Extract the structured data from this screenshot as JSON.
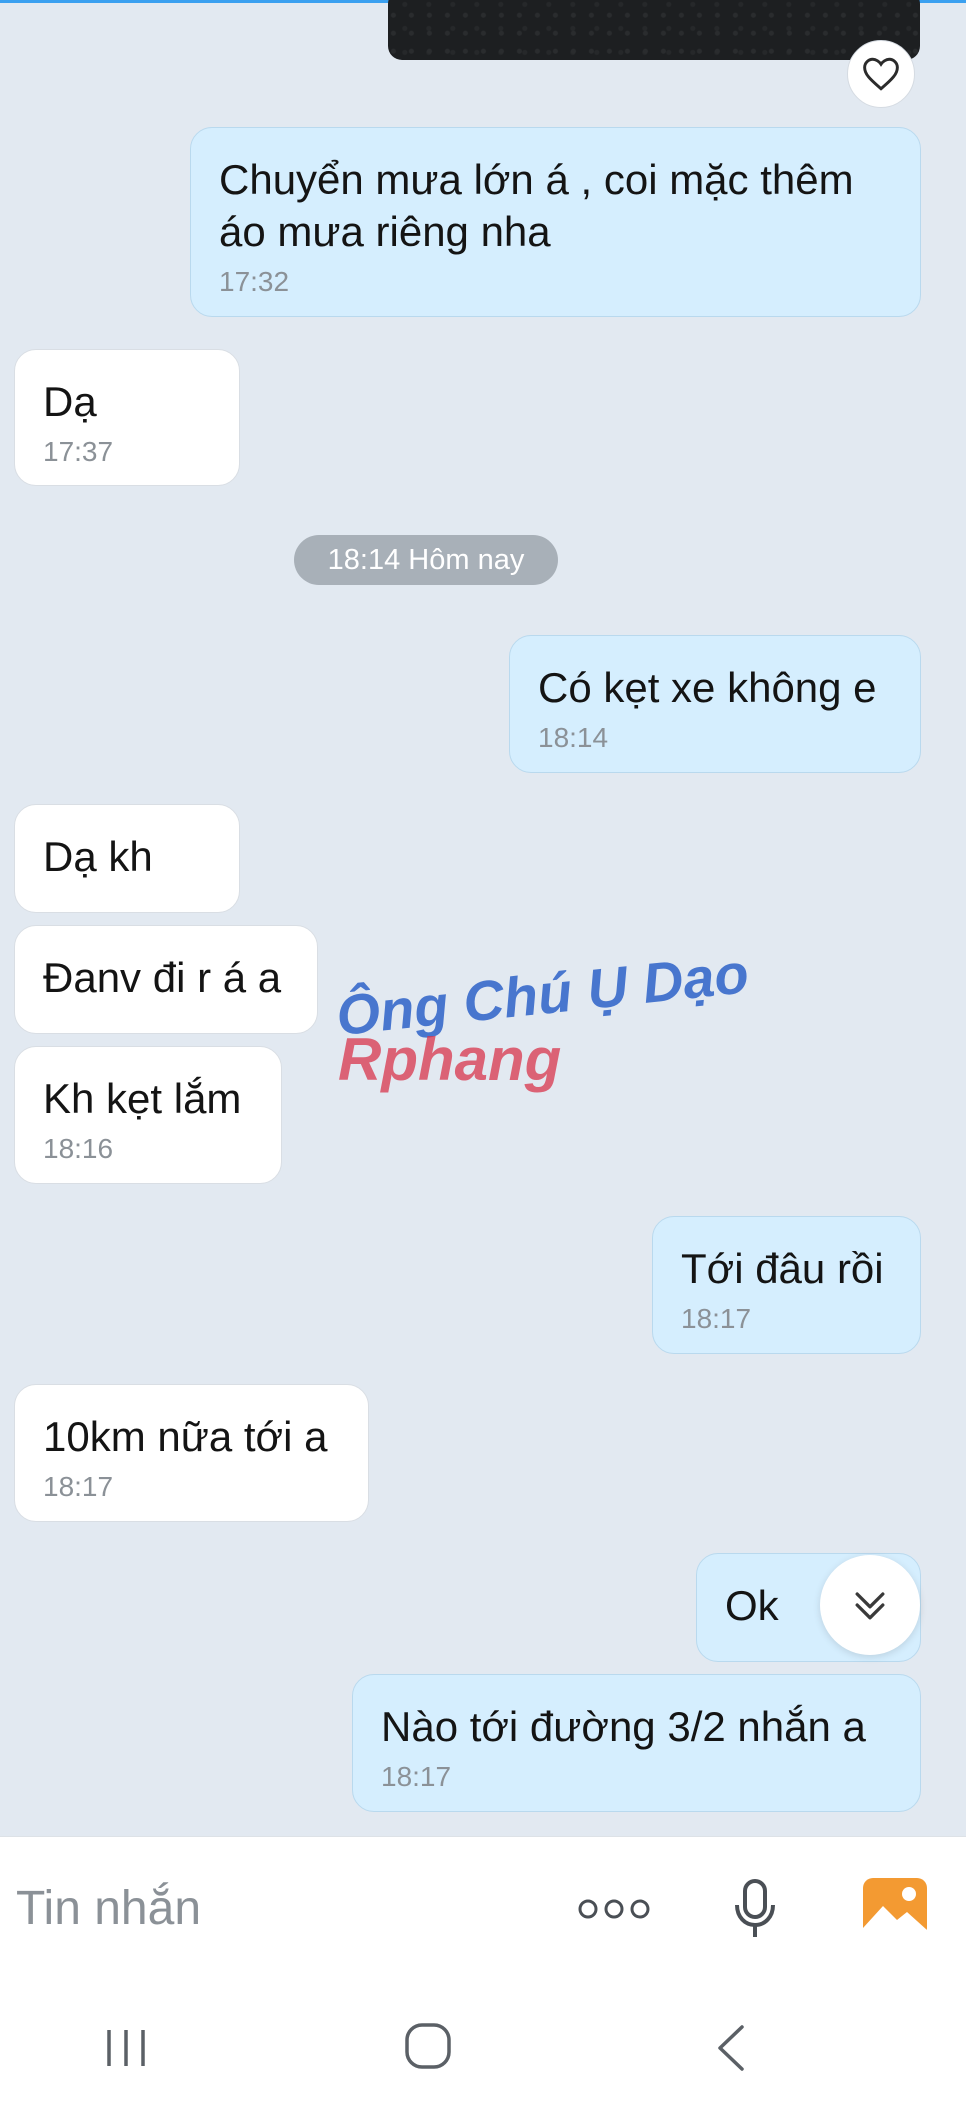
{
  "messages": [
    {
      "dir": "out",
      "text": "Chuyển mưa lớn á , coi mặc thêm",
      "text2": "áo mưa riêng nha",
      "time": "17:32"
    },
    {
      "dir": "in",
      "text": "Dạ",
      "time": "17:37"
    },
    {
      "dir": "out",
      "text": "Có kẹt xe không e",
      "time": "18:14"
    },
    {
      "dir": "in",
      "text": "Dạ kh"
    },
    {
      "dir": "in",
      "text": "Đanv đi r á a"
    },
    {
      "dir": "in",
      "text": "Kh kẹt lắm",
      "time": "18:16"
    },
    {
      "dir": "out",
      "text": "Tới đâu rồi",
      "time": "18:17"
    },
    {
      "dir": "in",
      "text": "10km nữa tới a",
      "time": "18:17"
    },
    {
      "dir": "out",
      "text": "Ok"
    },
    {
      "dir": "out",
      "text": "Nào tới đường 3/2 nhắn a",
      "time": "18:17"
    }
  ],
  "date_separator": "18:14 Hôm nay",
  "watermark": {
    "line1": "Ông Chú Ụ Dạo",
    "line2": "Rphang"
  },
  "composer": {
    "placeholder": "Tin nhắn"
  },
  "icons": {
    "like": "heart-icon",
    "scroll": "double-chevron-down-icon",
    "more": "more-dots-icon",
    "mic": "microphone-icon",
    "gallery": "image-gallery-icon",
    "recents": "recents-nav-icon",
    "home": "home-nav-icon",
    "back": "back-nav-icon"
  },
  "colors": {
    "chat_bg": "#e2e9f1",
    "out_bubble": "#d5eefe",
    "in_bubble": "#ffffff",
    "gallery_icon": "#f39a32"
  }
}
